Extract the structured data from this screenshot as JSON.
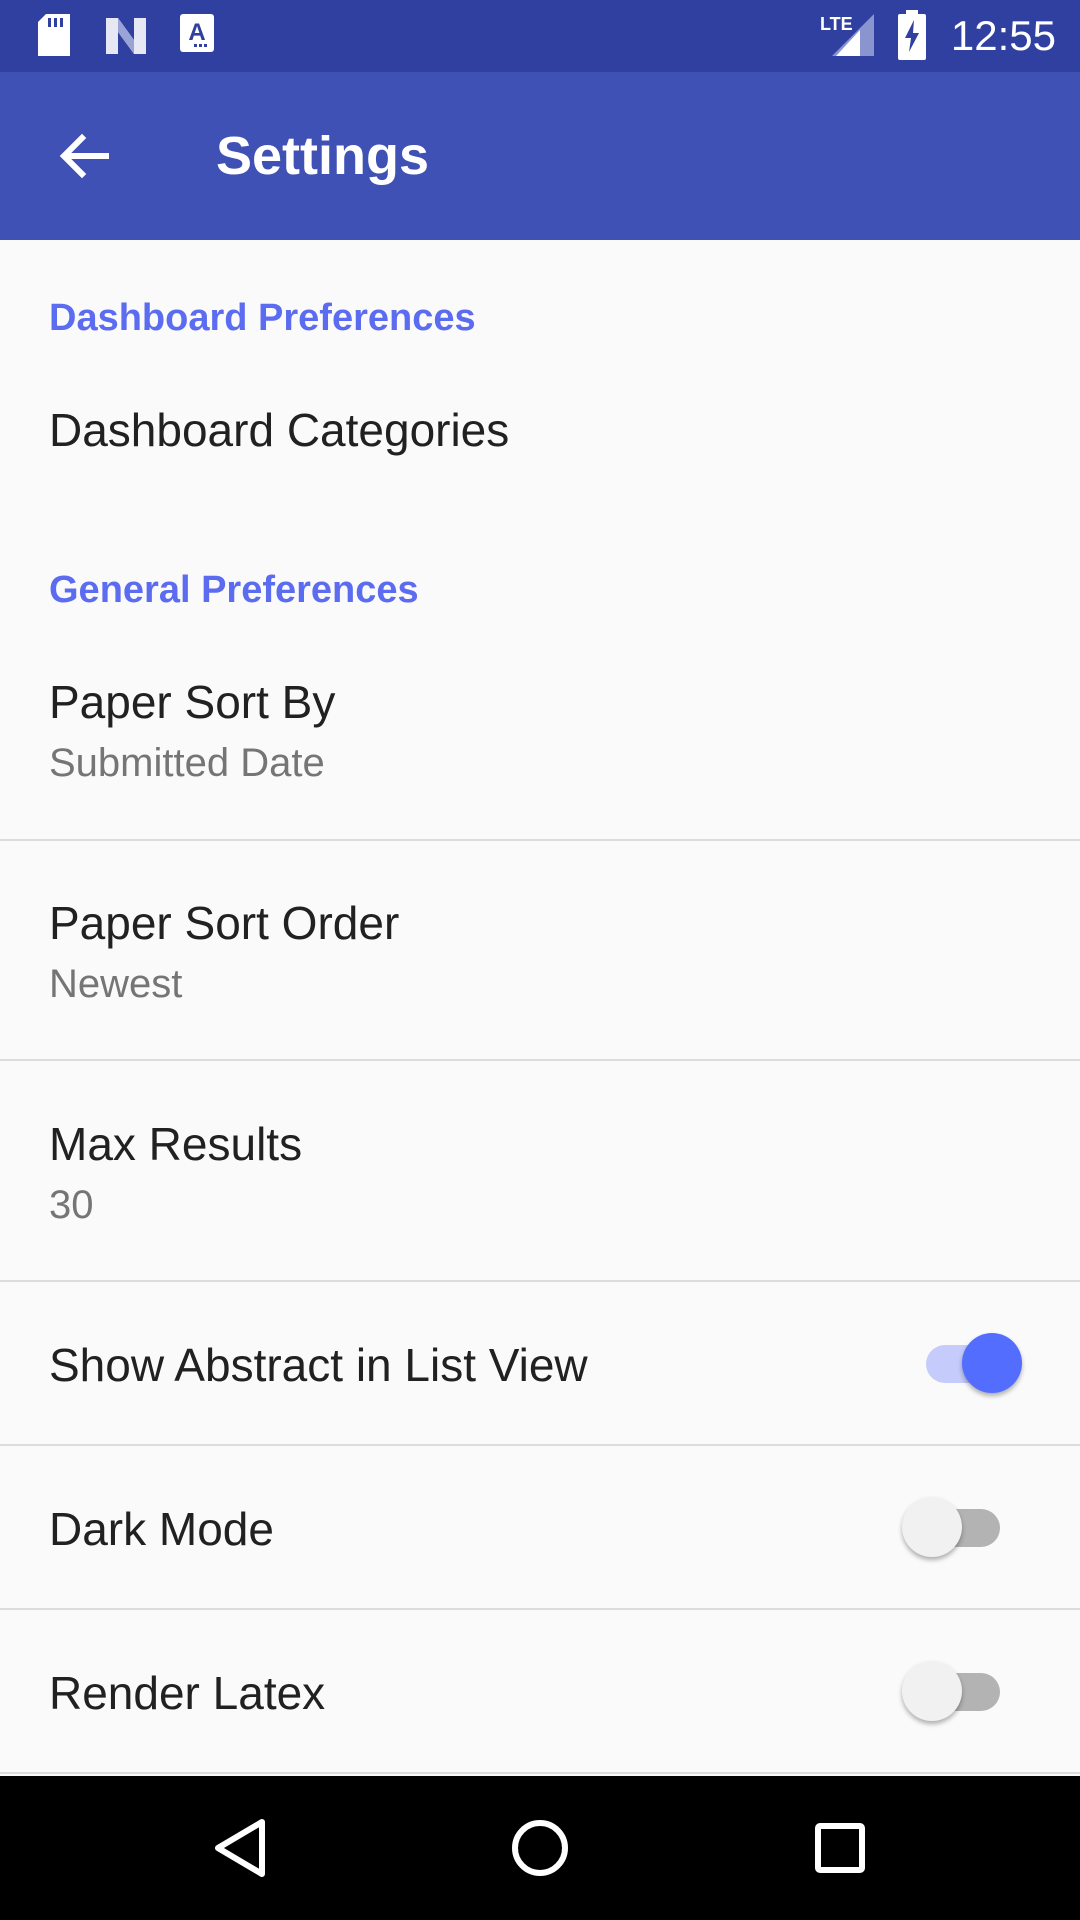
{
  "status_bar": {
    "time": "12:55",
    "icons": [
      "sd-card-icon",
      "notification-n-icon",
      "keyboard-a-icon",
      "lte-signal-icon",
      "battery-charging-icon"
    ],
    "network_label": "LTE"
  },
  "app_bar": {
    "title": "Settings",
    "back_icon": "arrow-back-icon"
  },
  "sections": [
    {
      "header": "Dashboard Preferences",
      "items": [
        {
          "title": "Dashboard Categories"
        }
      ]
    },
    {
      "header": "General Preferences",
      "items": [
        {
          "title": "Paper Sort By",
          "summary": "Submitted Date"
        },
        {
          "title": "Paper Sort Order",
          "summary": "Newest"
        },
        {
          "title": "Max Results",
          "summary": "30"
        },
        {
          "title": "Show Abstract in List View",
          "switch_on": true
        },
        {
          "title": "Dark Mode",
          "switch_on": false
        },
        {
          "title": "Render Latex",
          "switch_on": false
        }
      ]
    }
  ],
  "nav_bar": {
    "buttons": [
      "back-triangle-icon",
      "home-circle-icon",
      "recents-square-icon"
    ]
  },
  "colors": {
    "status_bar": "#3040a0",
    "app_bar": "#3f51b5",
    "accent": "#536dfe",
    "section_header": "#5c6cf0"
  }
}
